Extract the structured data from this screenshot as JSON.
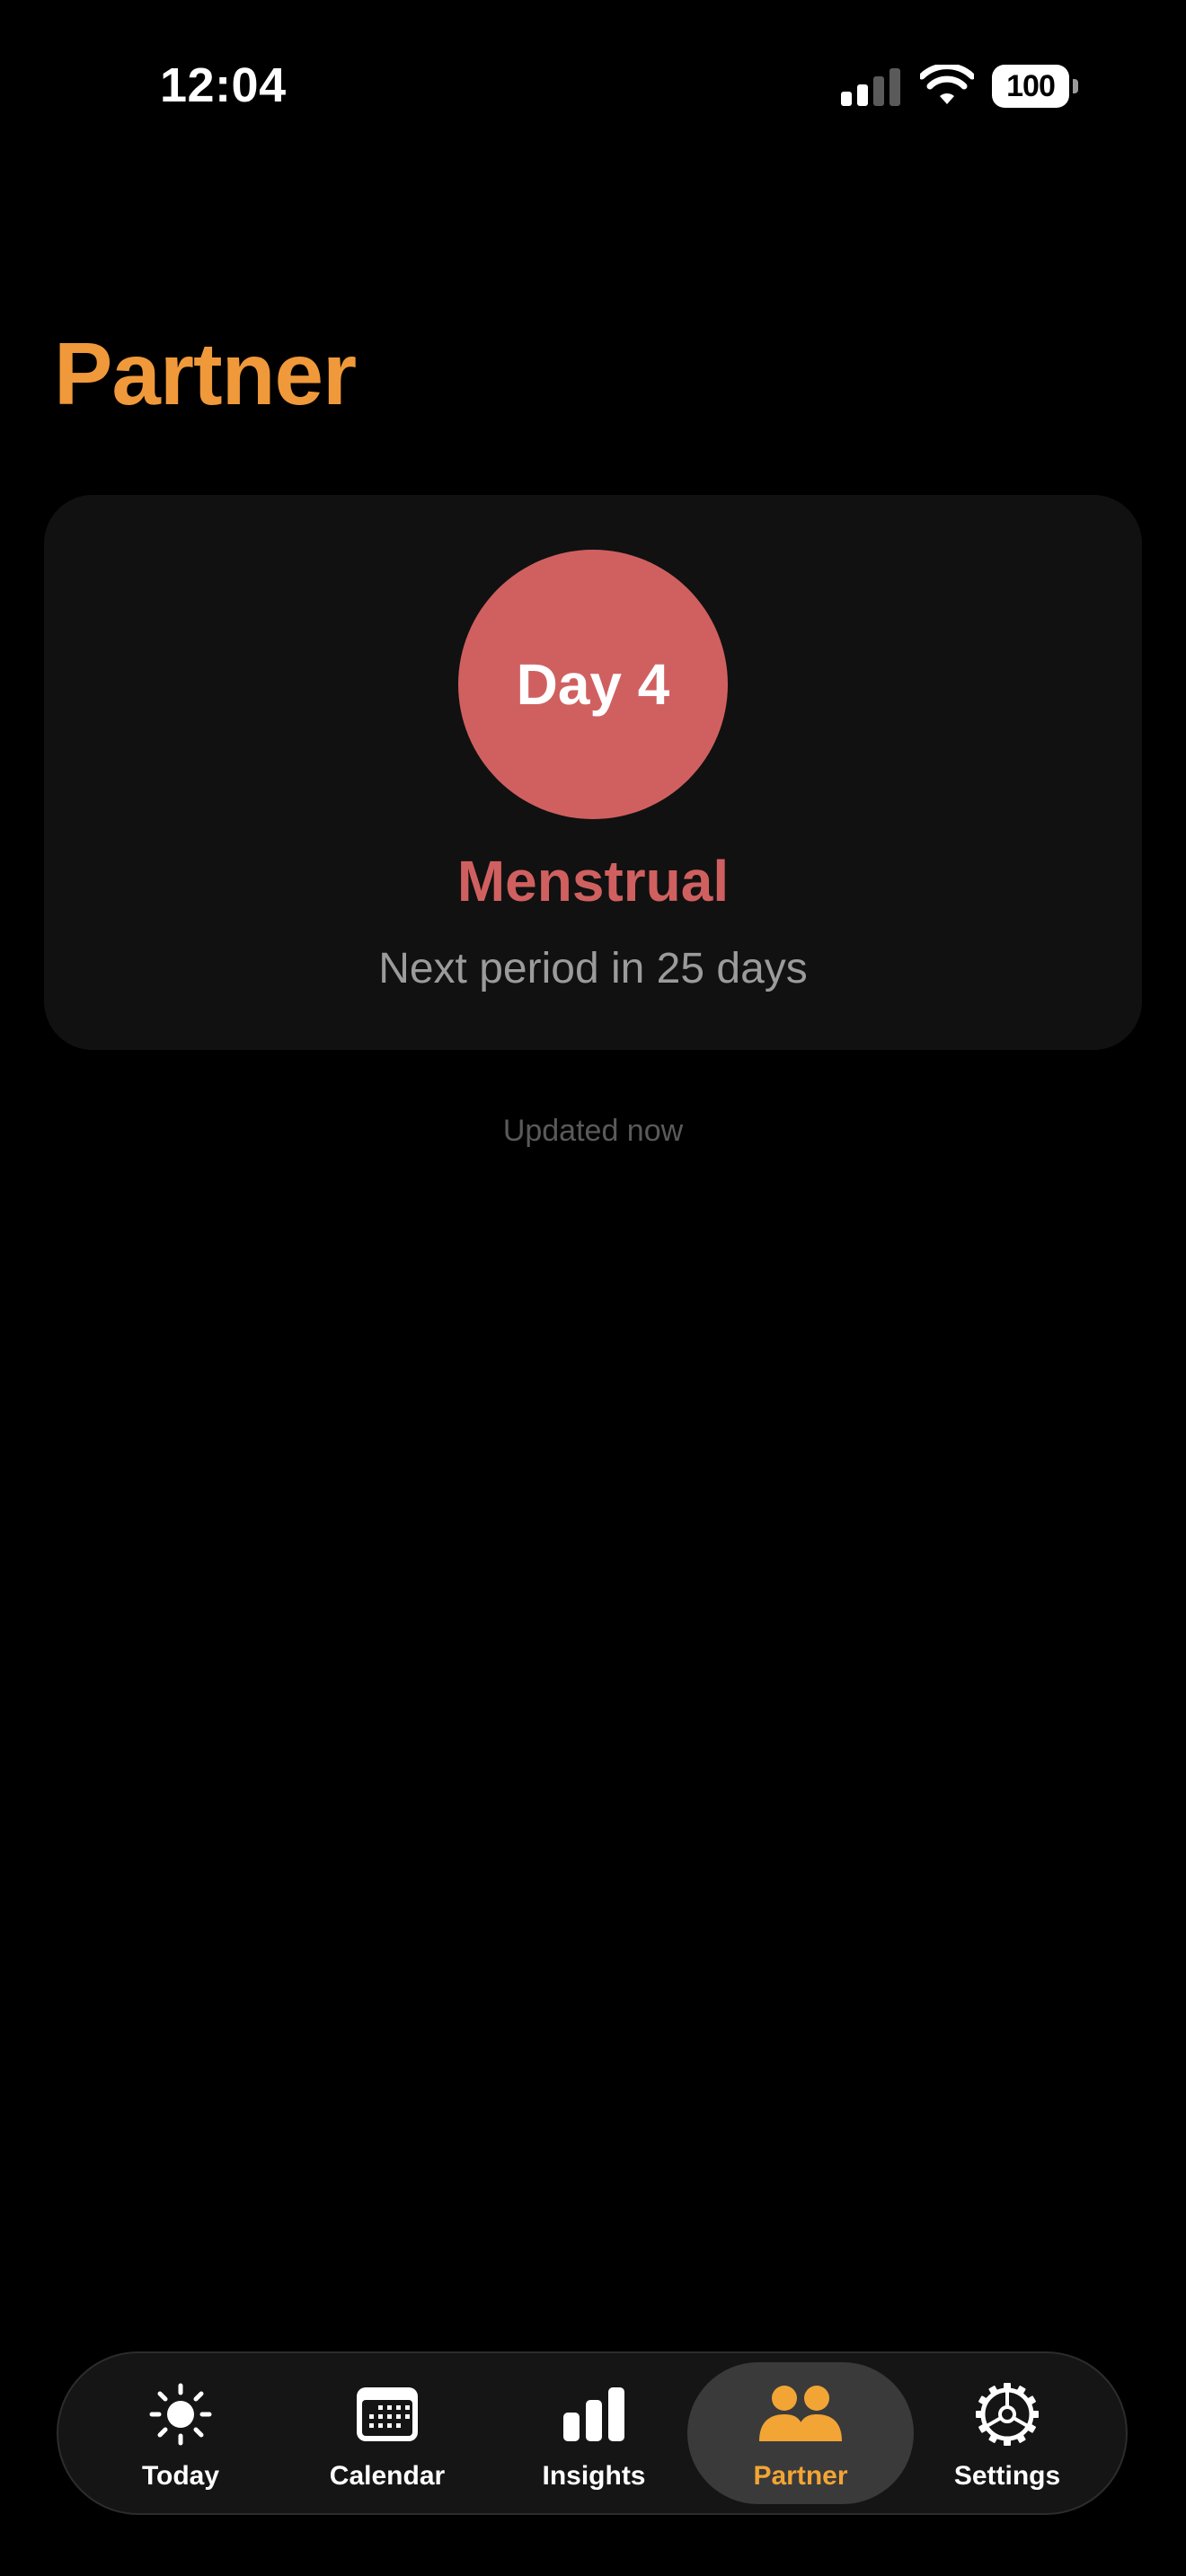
{
  "status_bar": {
    "time": "12:04",
    "battery": "100"
  },
  "page": {
    "title": "Partner"
  },
  "cycle_card": {
    "day_label": "Day 4",
    "phase": "Menstrual",
    "next_period": "Next period in 25 days"
  },
  "updated_text": "Updated now",
  "tab_bar": {
    "items": [
      {
        "label": "Today",
        "icon": "sun-icon"
      },
      {
        "label": "Calendar",
        "icon": "calendar-icon"
      },
      {
        "label": "Insights",
        "icon": "bar-chart-icon"
      },
      {
        "label": "Partner",
        "icon": "people-icon",
        "active": true
      },
      {
        "label": "Settings",
        "icon": "gear-icon"
      }
    ]
  },
  "colors": {
    "accent": "#f0993a",
    "phase": "#d06060",
    "active_tab": "#f2a535"
  }
}
